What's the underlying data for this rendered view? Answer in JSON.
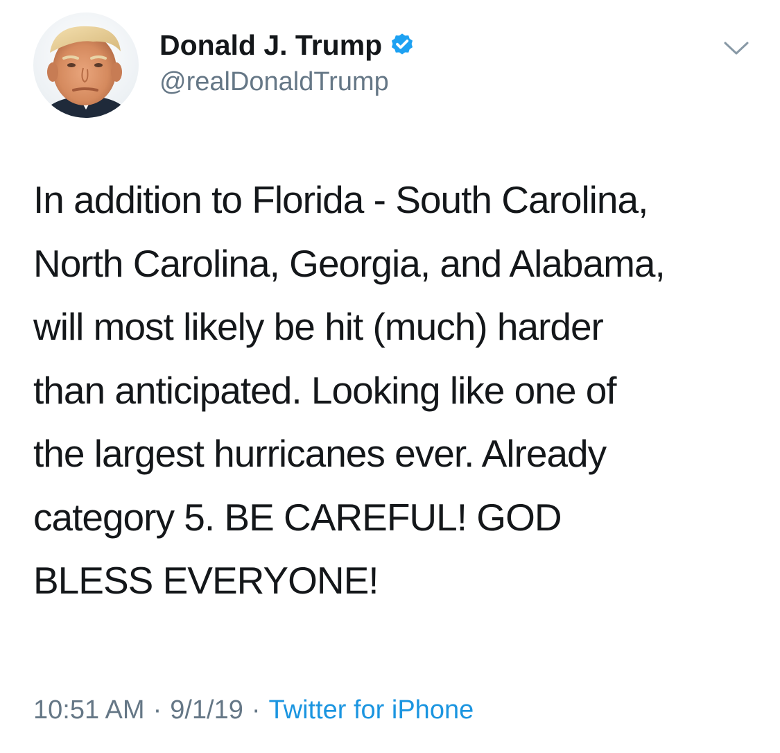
{
  "author": {
    "display_name": "Donald J. Trump",
    "handle": "@realDonaldTrump",
    "verified": true
  },
  "tweet": {
    "text": "In addition to Florida - South Carolina,\nNorth Carolina, Georgia, and Alabama,\nwill most likely be hit (much) harder\nthan anticipated. Looking like one of\nthe largest hurricanes ever. Already\ncategory 5. BE CAREFUL! GOD\nBLESS EVERYONE!"
  },
  "meta": {
    "time": "10:51 AM",
    "separator": "·",
    "date": "9/1/19",
    "source": "Twitter for iPhone"
  },
  "icons": {
    "verified": "verified-badge-icon",
    "menu": "chevron-down-icon"
  },
  "colors": {
    "text": "#14171a",
    "secondary": "#657786",
    "link": "#1b95e0",
    "verified": "#1da1f2"
  }
}
